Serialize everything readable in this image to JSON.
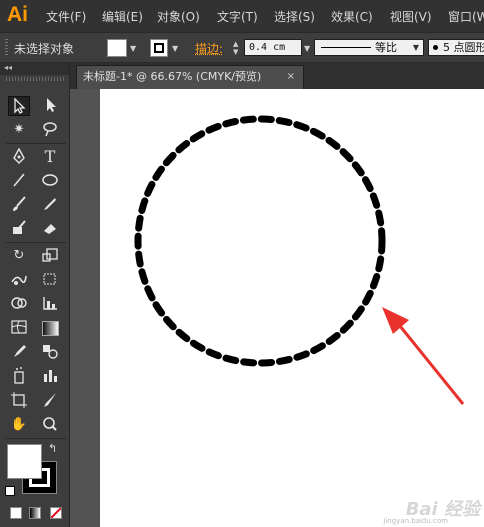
{
  "app": {
    "logo_text": "Ai",
    "logo_color": "#ff9a00"
  },
  "menu": [
    "文件(F)",
    "编辑(E)",
    "对象(O)",
    "文字(T)",
    "选择(S)",
    "效果(C)",
    "视图(V)",
    "窗口(W)"
  ],
  "control_bar": {
    "selection_status": "未选择对象",
    "stroke_label": "描边:",
    "stroke_label_color": "#ff9f1c",
    "stroke_weight": "0.4 cm",
    "profile_label": "等比",
    "brush_label": "5 点圆形"
  },
  "document_tab": {
    "title": "未标题-1* @ 66.67% (CMYK/预览)",
    "close": "×"
  },
  "tools": [
    "selection-tool",
    "direct-selection-tool",
    "magic-wand-tool",
    "lasso-tool",
    "pen-tool",
    "type-tool",
    "line-segment-tool",
    "ellipse-tool",
    "paintbrush-tool",
    "pencil-tool",
    "blob-brush-tool",
    "eraser-tool",
    "rotate-tool",
    "scale-tool",
    "warp-tool",
    "free-transform-tool",
    "shape-builder-tool",
    "graph-tool",
    "mesh-tool",
    "gradient-tool",
    "eyedropper-tool",
    "blend-tool",
    "symbol-sprayer-tool",
    "column-graph-tool",
    "artboard-tool",
    "slice-tool",
    "hand-tool",
    "zoom-tool"
  ],
  "colors": {
    "fill": "#ffffff",
    "stroke": "#000000",
    "arrow": "#e8322b"
  },
  "watermark": {
    "text": "Bai 经验",
    "sub": "jingyan.baidu.com"
  }
}
